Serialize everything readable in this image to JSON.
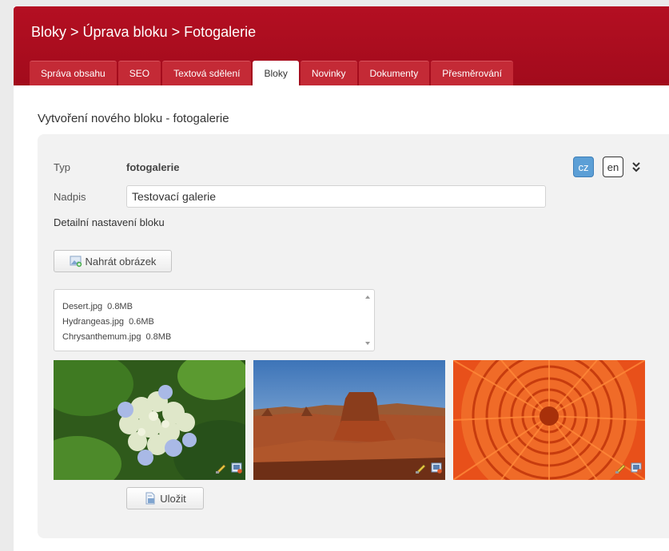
{
  "breadcrumb": {
    "items": [
      "Bloky",
      "Úprava bloku",
      "Fotogalerie"
    ],
    "separator": ">"
  },
  "tabs": [
    {
      "label": "Správa obsahu",
      "active": false
    },
    {
      "label": "SEO",
      "active": false
    },
    {
      "label": "Textová sdělení",
      "active": false
    },
    {
      "label": "Bloky",
      "active": true
    },
    {
      "label": "Novinky",
      "active": false
    },
    {
      "label": "Dokumenty",
      "active": false
    },
    {
      "label": "Přesměrování",
      "active": false
    }
  ],
  "heading": "Vytvoření nového bloku - fotogalerie",
  "form": {
    "type_label": "Typ",
    "type_value": "fotogalerie",
    "title_label": "Nadpis",
    "title_value": "Testovací galerie",
    "detail_label": "Detailní nastavení bloku",
    "upload_label": "Nahrát obrázek",
    "save_label": "Uložit"
  },
  "languages": [
    {
      "code": "cz",
      "active": true
    },
    {
      "code": "en",
      "active": false
    }
  ],
  "files": [
    {
      "name": "Desert.jpg",
      "size": "0.8MB"
    },
    {
      "name": "Hydrangeas.jpg",
      "size": "0.6MB"
    },
    {
      "name": "Chrysanthemum.jpg",
      "size": "0.8MB"
    }
  ],
  "colors": {
    "brand": "#a8101f",
    "tab": "#c42a36",
    "lang_active": "#5c9fd6"
  },
  "icons": {
    "expand": "double-chevron-down-icon",
    "upload": "image-upload-icon",
    "save": "save-document-icon",
    "edit": "edit-pencil-icon",
    "remove": "remove-image-icon"
  }
}
